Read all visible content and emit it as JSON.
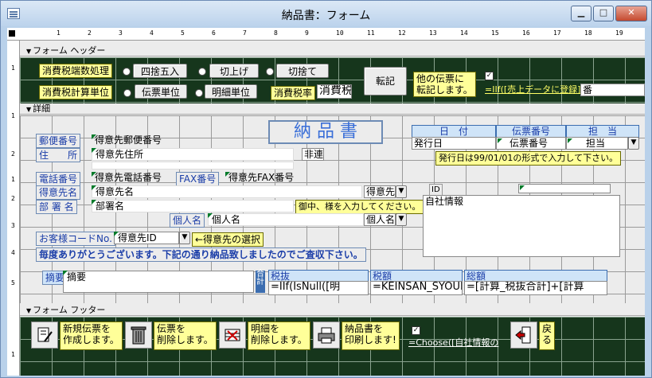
{
  "window": {
    "title": "納品書：フォーム"
  },
  "ruler": {
    "h_ticks": [
      "1",
      "2",
      "3",
      "4",
      "5",
      "6",
      "7",
      "8",
      "9",
      "10",
      "11",
      "12",
      "13",
      "14",
      "15",
      "16",
      "17",
      "18",
      "19",
      "20"
    ],
    "v_ticks": [
      "1",
      "1",
      "2",
      "1",
      "2",
      "3",
      "4",
      "5",
      "1"
    ]
  },
  "sections": {
    "header": "フォーム ヘッダー",
    "detail": "詳細",
    "footer": "フォーム フッター"
  },
  "header": {
    "tax_rounding_label": "消費税端数処理",
    "round_label": "四捨五入",
    "ceil_label": "切上げ",
    "floor_label": "切捨て",
    "tax_unit_label": "消費税計算単位",
    "slip_unit_label": "伝票単位",
    "detail_unit_label": "明細単位",
    "tax_rate_label": "消費税率",
    "tax_rate_value": "消費税",
    "transfer_button": "転記",
    "transfer_note": "他の伝票に\n転記します。",
    "iif_text": "=IIf([売上データに登録]",
    "number_box": "番"
  },
  "detail": {
    "form_title": "納 品 書",
    "heading_date": "日　付",
    "heading_slip": "伝票番号",
    "heading_staff": "担　当",
    "date_field": "発行日",
    "slip_field": "伝票番号",
    "staff_field": "担当",
    "date_note": "発行日は99/01/01の形式で入力して下さい。",
    "postal_label": "郵便番号",
    "postal_field": "得意先郵便番号",
    "address_label": "住　　所",
    "address_field": "得意先住所",
    "link_label": "非連",
    "phone_label": "電話番号",
    "phone_field": "得意先電話番号",
    "fax_label": "FAX番号",
    "fax_field": "得意先FAX番号",
    "customer_name_label": "得意先名",
    "customer_name_field": "得意先名",
    "customer_combo": "得意先",
    "department_label": "部 署 名",
    "department_field": "部署名",
    "department_tip": "御中、様を入力してください。",
    "person_label": "個人名",
    "person_field": "個人名",
    "person_combo": "個人名",
    "id_label": "ID",
    "company_info": "自社情報",
    "customer_code_label": "お客様コードNo.",
    "customer_id_field": "得意先ID",
    "customer_select_note": "←得意先の選択",
    "thanks_text": "毎度ありがとうございます。下記の通り納品致しましたのでご査収下さい。",
    "summary_label": "摘要",
    "summary_field": "摘要",
    "total_label": "合計",
    "pretax_label": "税抜",
    "pretax_field": "=IIf(IsNull([明",
    "tax_label": "税額",
    "tax_field": "=KEINSAN_SYOUH",
    "grand_label": "総額",
    "grand_field": "=[計算_税抜合計]+[計算"
  },
  "footer": {
    "new_note": "新規伝票を\n作成します。",
    "delete_slip_note": "伝票を\n削除します。",
    "delete_detail_note": "明細を\n削除します。",
    "print_note": "納品書を\n印刷します!",
    "choose_text": "=Choose([自社情報の",
    "back_note": "戻\nる"
  }
}
